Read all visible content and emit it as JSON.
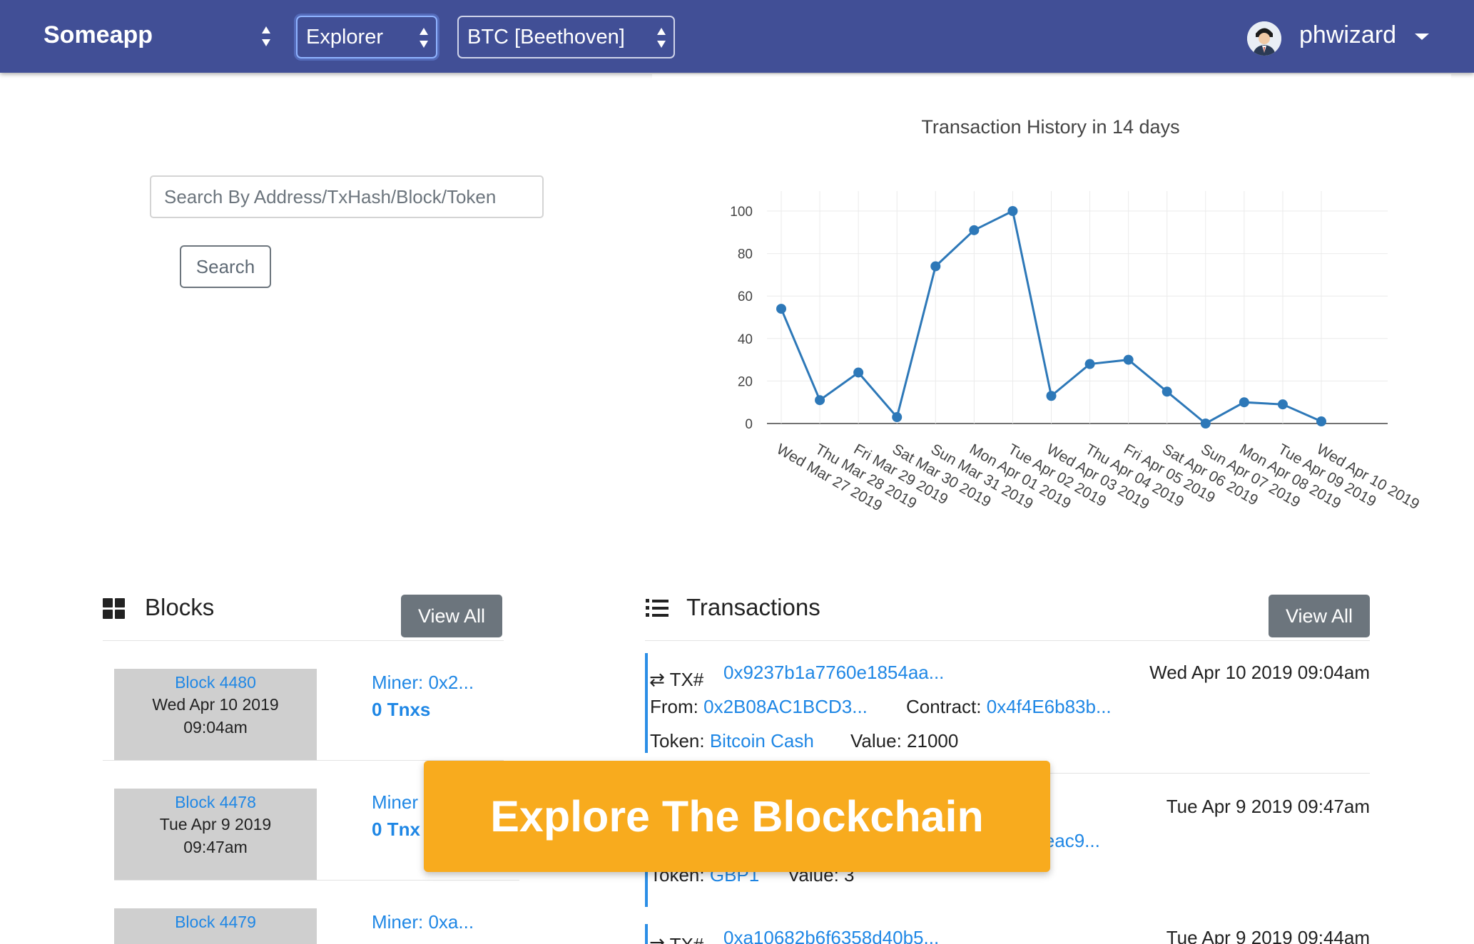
{
  "navbar": {
    "brand": "Someapp",
    "explorer_select": "Explorer",
    "network_select": "BTC [Beethoven]",
    "username": "phwizard",
    "avatar_icon": "user-avatar-icon"
  },
  "search": {
    "placeholder": "Search By Address/TxHash/Block/Token",
    "button_label": "Search"
  },
  "chart_data": {
    "type": "line",
    "title": "Transaction History in 14 days",
    "x": [
      "Wed Mar 27 2019",
      "Thu Mar 28 2019",
      "Fri Mar 29 2019",
      "Sat Mar 30 2019",
      "Sun Mar 31 2019",
      "Mon Apr 01 2019",
      "Tue Apr 02 2019",
      "Wed Apr 03 2019",
      "Thu Apr 04 2019",
      "Fri Apr 05 2019",
      "Sat Apr 06 2019",
      "Sun Apr 07 2019",
      "Mon Apr 08 2019",
      "Tue Apr 09 2019",
      "Wed Apr 10 2019"
    ],
    "series": [
      {
        "values": [
          54,
          11,
          24,
          3,
          74,
          91,
          100,
          13,
          28,
          30,
          15,
          0,
          10,
          9,
          1
        ]
      }
    ],
    "ylim": [
      0,
      100
    ],
    "yticks": [
      0,
      20,
      40,
      60,
      80,
      100
    ],
    "xlabel": "",
    "ylabel": "",
    "grid": true,
    "color": "#2d78b8"
  },
  "blocks": {
    "title": "Blocks",
    "view_all": "View All",
    "icon": "grid-icon",
    "items": [
      {
        "link": "Block 4480",
        "date": "Wed Apr 10 2019",
        "time": "09:04am",
        "miner": "Miner: 0x2...",
        "tnxs": "0 Tnxs"
      },
      {
        "link": "Block 4478",
        "date": "Tue Apr 9 2019",
        "time": "09:47am",
        "miner": "Miner",
        "tnxs": "0 Tnx"
      },
      {
        "link": "Block 4479",
        "date": "",
        "time": "",
        "miner": "Miner: 0xa...",
        "tnxs": ""
      }
    ]
  },
  "transactions": {
    "title": "Transactions",
    "view_all": "View All",
    "icon": "list-icon",
    "exchange_icon": "exchange-icon",
    "tx_label": "TX#",
    "items": [
      {
        "hash": "0x9237b1a7760e1854aa...",
        "date": "Wed Apr 10 2019 09:04am",
        "from_label": "From:",
        "from": "0x2B08AC1BCD3...",
        "contract_label": "Contract:",
        "contract": "0x4f4E6b83b...",
        "token_label": "Token:",
        "token": "Bitcoin Cash",
        "value_label": "Value:",
        "value": "21000"
      },
      {
        "hash": "",
        "date": "Tue Apr 9 2019 09:47am",
        "from_label": "",
        "from": "",
        "contract_label": "",
        "contract": "E2eac9...",
        "token_label": "Token:",
        "token": "GBP1",
        "value_label": "Value:",
        "value": "3"
      },
      {
        "hash": "0xa10682b6f6358d40b5...",
        "date": "Tue Apr 9 2019 09:44am"
      }
    ]
  },
  "banner": {
    "text": "Explore The Blockchain"
  }
}
